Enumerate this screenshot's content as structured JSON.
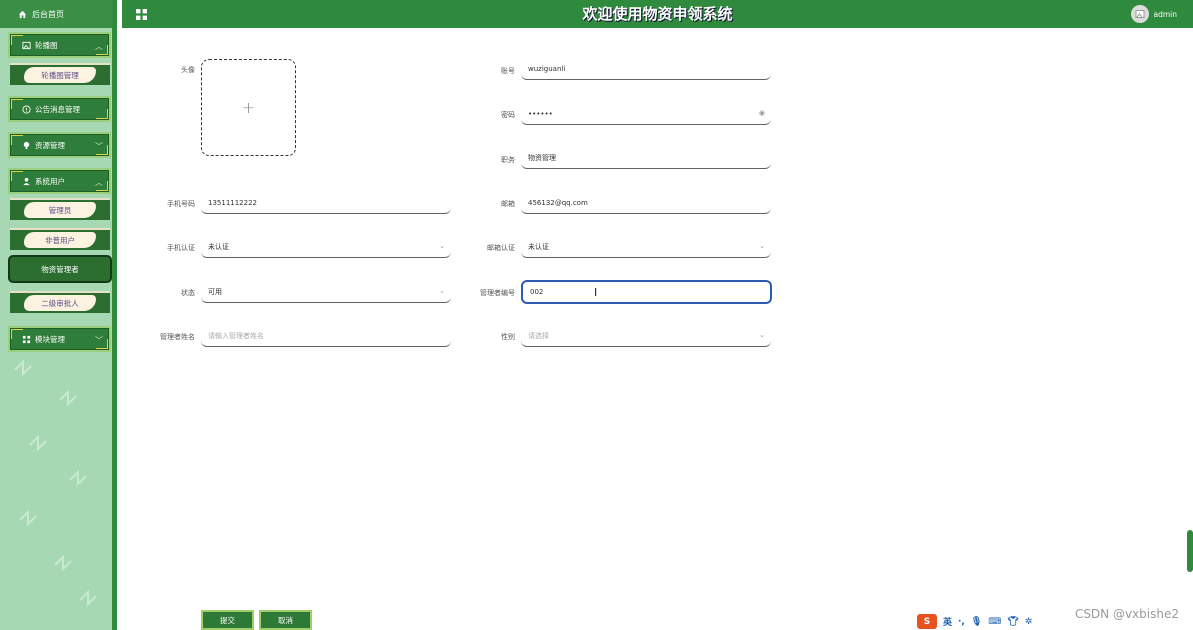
{
  "header": {
    "title": "欢迎使用物资申领系统",
    "username": "admin"
  },
  "sidebar": {
    "home": "后台首页",
    "menus": [
      {
        "label": "轮播图",
        "icon": "image-icon"
      },
      {
        "label": "公告消息管理",
        "icon": "info-icon"
      },
      {
        "label": "资源管理",
        "icon": "bulb-icon"
      },
      {
        "label": "系统用户",
        "icon": "user-icon"
      },
      {
        "label": "模块管理",
        "icon": "apps-icon"
      }
    ],
    "subs": {
      "carousel": "轮播图管理",
      "admin": "管理员",
      "normal_user": "非普用户",
      "supply_manager": "物资管理者",
      "second_approver": "二级审批人"
    }
  },
  "form": {
    "avatar_label": "头像",
    "account": {
      "label": "账号",
      "value": "wuziguanli"
    },
    "password": {
      "label": "密码",
      "value": "••••••"
    },
    "role": {
      "label": "职务",
      "value": "物资管理"
    },
    "phone": {
      "label": "手机号码",
      "value": "13511112222"
    },
    "email": {
      "label": "邮箱",
      "value": "456132@qq.com"
    },
    "phone_verify": {
      "label": "手机认证",
      "value": "未认证"
    },
    "email_verify": {
      "label": "邮箱认证",
      "value": "未认证"
    },
    "status": {
      "label": "状态",
      "value": "可用"
    },
    "manager_no": {
      "label": "管理者编号",
      "value": "002"
    },
    "manager_name": {
      "label": "管理者姓名",
      "placeholder": "请输入管理者姓名"
    },
    "gender": {
      "label": "性别",
      "placeholder": "请选择"
    }
  },
  "buttons": {
    "submit": "提交",
    "cancel": "取消"
  },
  "ime": {
    "mode": "英"
  },
  "watermark": "CSDN @vxbishe2",
  "colors": {
    "primary": "#2f8a3e",
    "sidebar_bg": "#a6d9b3",
    "focus": "#2a5db0"
  }
}
